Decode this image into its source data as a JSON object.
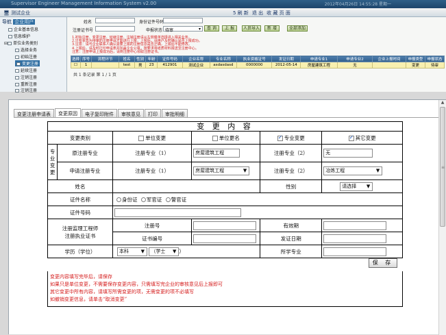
{
  "topbar": {
    "app_title": "Supervisor Engineer Management Information System v2.00",
    "version_text": "2012年04月26日 14:55:28 星期一",
    "icon": "computer-icon",
    "sys_name": "测试企业",
    "links": [
      "5 刷 新",
      "退 出",
      "收 藏 页 面"
    ]
  },
  "nav": {
    "head_label": "导航",
    "head_value": "企业用户",
    "items": [
      "企业基本信息",
      "信息维护",
      "单位业务类别",
      "选择业务",
      "初始注册",
      "变更注册",
      "延续注册",
      "注销注册",
      "重新注册",
      "注销注册"
    ],
    "selected_index": 5
  },
  "filter": {
    "name_label": "姓名",
    "idtype_label": "身份证件号码",
    "cert_label": "注册证书号",
    "status_label": "申报状态",
    "status_value": "待审",
    "buttons": [
      "查 询",
      "上 报",
      "人员导入",
      "新 增",
      "全部添加"
    ]
  },
  "notices": [
    "1.初始注册、变更注册、延续注册、注销注册请从左侧菜单选择进入相关业务。",
    "2.只有状态为待审的注册申请才能进行上报，上报后，请用户及时确认是否上报成功。",
    "3.注意：请与企业联系人确认需要上报的注册信息是否正确，上报后不能修改。",
    "4.上报后，请及时打印申请表并加盖企业公章，按要求将纸质材料报送至注册中心。",
    "注意：注册申请上报成功后，请到注册中心领取注册证书。"
  ],
  "table": {
    "headers": [
      "选择",
      "序号",
      "流程环节",
      "姓名",
      "性别",
      "年龄",
      "证件号码",
      "企业名称",
      "专业名称",
      "执业资格证号",
      "发证日期",
      "申请专业1",
      "申请专业2",
      "企业上报时间",
      "申报类型",
      "申报状态"
    ],
    "rows": [
      [
        "☐",
        "1",
        "",
        "test",
        "男",
        "23",
        "412901",
        "测试企业",
        "asdasdasd",
        "0000000",
        "2012-05-14",
        "房屋建筑工程",
        "无",
        "",
        "变更",
        "待审"
      ]
    ],
    "pager": "共 1 条记录  第 1 / 1 页"
  },
  "tabs": [
    "变更注册申请表",
    "变更原因",
    "电子复印附件",
    "审核意见",
    "打印",
    "审批明细"
  ],
  "active_tab": 1,
  "form": {
    "title": "变 更 内 容",
    "change_type_label": "变更类别",
    "options": [
      {
        "label": "单位变更",
        "checked": false
      },
      {
        "label": "单位更名",
        "checked": false
      },
      {
        "label": "专业变更",
        "checked": true
      },
      {
        "label": "其它变更",
        "checked": true
      }
    ],
    "major_group_label": "专业变更",
    "orig_major_label": "原注册专业",
    "apply_major_label": "申请注册专业",
    "reg_major1_label": "注册专业（1）",
    "reg_major2_label": "注册专业（2）",
    "orig_major1": "房屋建筑工程",
    "orig_major2": "无",
    "apply_major1": "房屋建筑工程",
    "apply_major2": "冶炼工程",
    "name_label": "姓名",
    "gender_label": "性别",
    "gender_value": "请选择",
    "idtype_label": "证件名称",
    "idtypes": [
      "身份证",
      "军官证",
      "警官证"
    ],
    "idno_label": "证件号码",
    "reg_group_label": "注册监理工程师注册执业证书",
    "reg_no_label": "注册号",
    "valid_label": "有效期",
    "cert_no_label": "证书编号",
    "issue_date_label": "发证日期",
    "edu_label": "学历（学位）",
    "edu_value": "本科",
    "degree_value": "（学士",
    "degree_suffix": "）",
    "major_label": "所学专业",
    "save_label": "保 存"
  },
  "form_notes": [
    "变更内容填写完毕后，请保存",
    "如果只是单位变更，不需要保存变更内容，只需填写完企业的审核意见后上报即可",
    "其它变更中所有内容，请填写所需变更的项，无需变更的项不必填写",
    "如撤销变更信息，请单击“取消变更”"
  ]
}
